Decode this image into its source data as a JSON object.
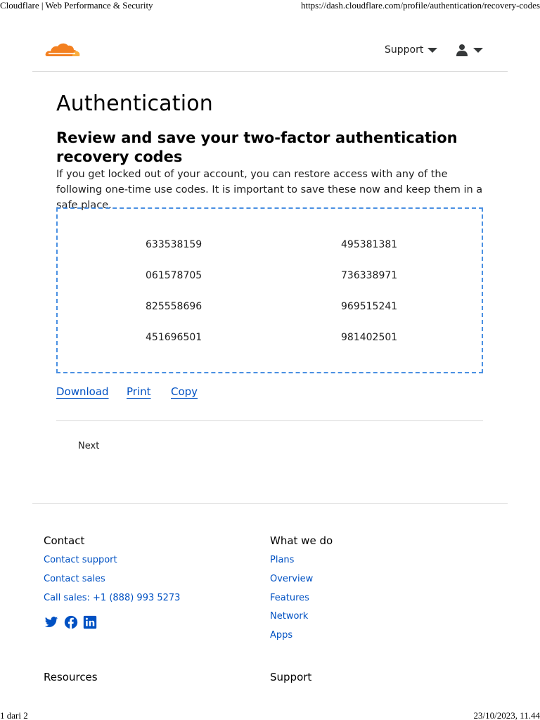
{
  "print": {
    "header_title": "Cloudflare | Web Performance & Security",
    "header_url": "https://dash.cloudflare.com/profile/authentication/recovery-codes",
    "footer_page": "1 dari 2",
    "footer_datetime": "23/10/2023, 11.44"
  },
  "nav": {
    "support_label": "Support",
    "icons": {
      "logo": "cloudflare-logo",
      "user": "user-icon",
      "caret": "chevron-down-icon"
    },
    "colors": {
      "logo_orange": "#f38020",
      "logo_light": "#faae40"
    }
  },
  "main": {
    "title": "Authentication",
    "section_title": "Review and save your two-factor authentication recovery codes",
    "description": "If you get locked out of your account, you can restore access with any of the following one-time use codes. It is important to save these now and keep them in a safe place.",
    "codes": [
      "633538159",
      "495381381",
      "061578705",
      "736338971",
      "825558696",
      "969515241",
      "451696501",
      "981402501"
    ],
    "actions": {
      "download": "Download",
      "print": "Print",
      "copy": "Copy"
    },
    "next_label": "Next",
    "colors": {
      "link": "#0051c3",
      "dashed_border": "#4a90e2"
    }
  },
  "footer": {
    "contact": {
      "heading": "Contact",
      "links": [
        "Contact support",
        "Contact sales",
        "Call sales: +1 (888) 993 5273"
      ]
    },
    "what_we_do": {
      "heading": "What we do",
      "links": [
        "Plans",
        "Overview",
        "Features",
        "Network",
        "Apps"
      ]
    },
    "resources_heading": "Resources",
    "support_heading": "Support",
    "social_icons": [
      "twitter-icon",
      "facebook-icon",
      "linkedin-icon"
    ]
  }
}
